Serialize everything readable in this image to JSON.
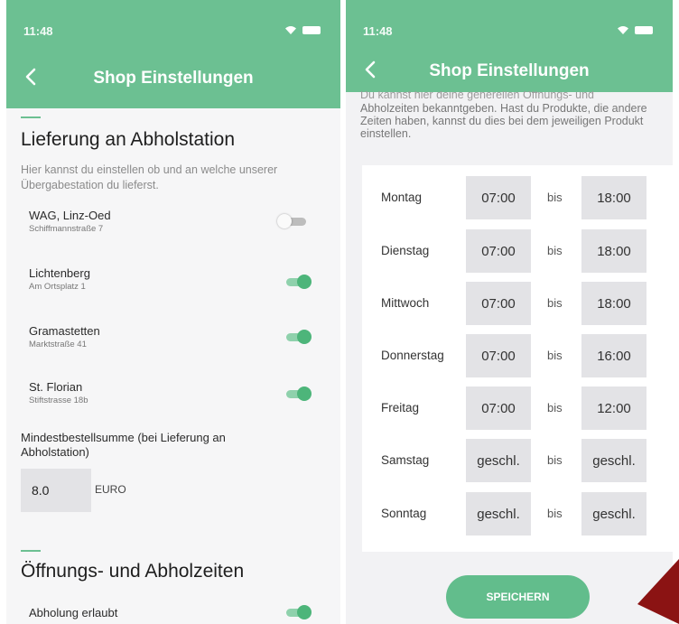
{
  "status": {
    "time": "11:48"
  },
  "header": {
    "title": "Shop Einstellungen"
  },
  "left": {
    "section1_title": "Lieferung an Abholstation",
    "section1_desc": "Hier kannst du einstellen ob und an welche unserer Übergabestation du lieferst.",
    "stations": [
      {
        "name": "WAG, Linz-Oed",
        "address": "Schiffmannstraße 7",
        "enabled": false
      },
      {
        "name": "Lichtenberg",
        "address": "Am Ortsplatz 1",
        "enabled": true
      },
      {
        "name": "Gramastetten",
        "address": "Marktstraße 41",
        "enabled": true
      },
      {
        "name": "St. Florian",
        "address": "Stiftstrasse 18b",
        "enabled": true
      }
    ],
    "min_order_label": "Mindestbestellsumme (bei Lieferung an Abholstation)",
    "min_order_value": "8.0",
    "min_order_unit": "EURO",
    "section2_title": "Öffnungs- und Abholzeiten",
    "pickup_label": "Abholung erlaubt",
    "pickup_enabled": true
  },
  "right": {
    "intro_cut": "Du kannst hier deine generellen Öffnungs- und",
    "intro": "Abholzeiten bekanntgeben. Hast du Produkte, die andere Zeiten haben, kannst du dies bei dem jeweiligen Produkt einstellen.",
    "bis": "bis",
    "days": [
      {
        "day": "Montag",
        "from": "07:00",
        "to": "18:00"
      },
      {
        "day": "Dienstag",
        "from": "07:00",
        "to": "18:00"
      },
      {
        "day": "Mittwoch",
        "from": "07:00",
        "to": "18:00"
      },
      {
        "day": "Donnerstag",
        "from": "07:00",
        "to": "16:00"
      },
      {
        "day": "Freitag",
        "from": "07:00",
        "to": "12:00"
      },
      {
        "day": "Samstag",
        "from": "geschl.",
        "to": "geschl."
      },
      {
        "day": "Sonntag",
        "from": "geschl.",
        "to": "geschl."
      }
    ],
    "save_label": "SPEICHERN"
  },
  "colors": {
    "accent": "#6cc092",
    "toggle_on": "#4db57a",
    "annotation_arrow": "#8b1313"
  },
  "icons": {
    "back": "chevron-left-icon",
    "wifi": "wifi-icon",
    "battery": "battery-icon",
    "location": "location-arrow-icon"
  }
}
